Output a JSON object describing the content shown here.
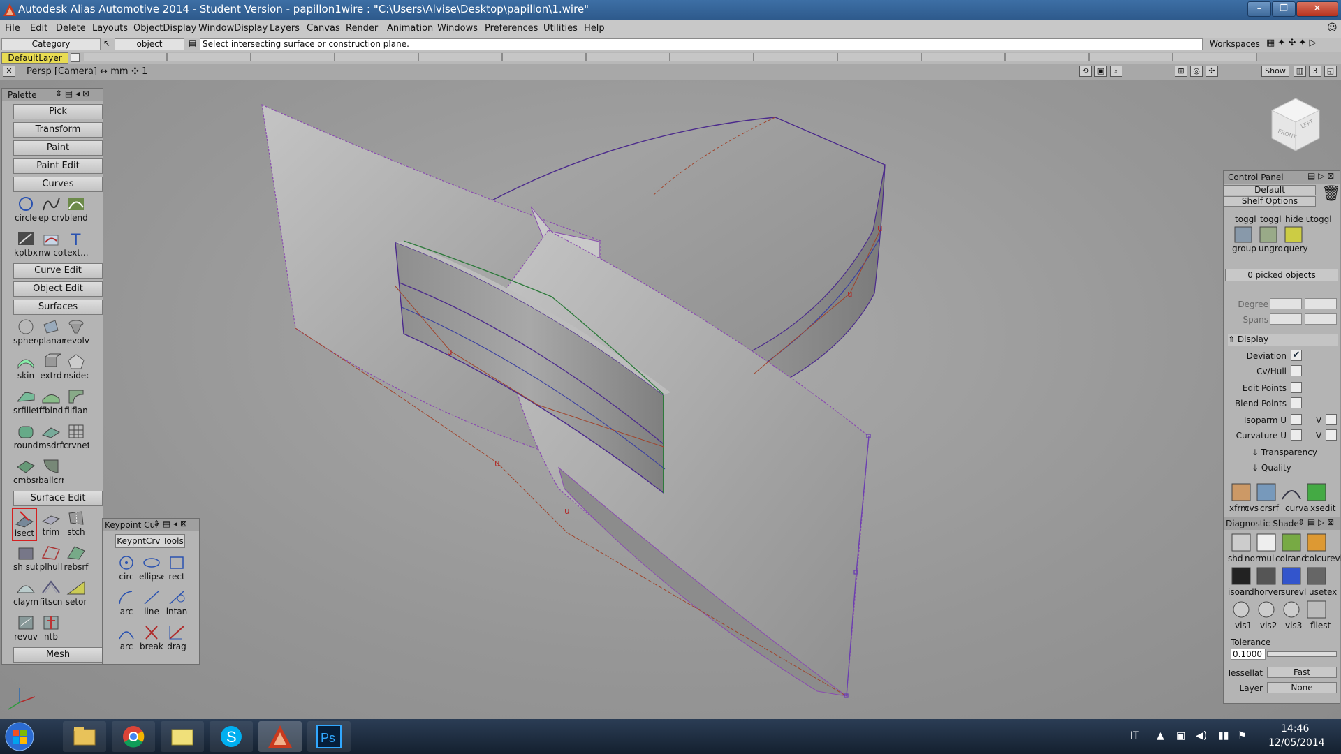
{
  "window": {
    "title": "Autodesk Alias Automotive 2014   - Student Version   - papillon1wire : \"C:\\Users\\Alvise\\Desktop\\papillon\\1.wire\"",
    "minimize": "–",
    "maximize": "❐",
    "close": "✕"
  },
  "menu": [
    "File",
    "Edit",
    "Delete",
    "Layouts",
    "ObjectDisplay",
    "WindowDisplay",
    "Layers",
    "Canvas",
    "Render",
    "Animation",
    "Windows",
    "Preferences",
    "Utilities",
    "Help"
  ],
  "toolbar": {
    "category_label": "Category",
    "object_label": "object",
    "prompt": "Select intersecting surface or construction plane.",
    "workspaces_label": "Workspaces"
  },
  "layer_bar": {
    "default_layer": "DefaultLayer"
  },
  "view_bar": {
    "camera": "Persp [Camera] ↔ mm",
    "count": "✣ 1",
    "show_label": "Show",
    "view_number": "3"
  },
  "palette": {
    "title": "Palette",
    "top_buttons": [
      "Pick",
      "Transform",
      "Paint",
      "Paint Edit"
    ],
    "curves_header": "Curves",
    "curves_tools": [
      "circle",
      "ep crv",
      "blend",
      "kptbx",
      "nw cos",
      "text..."
    ],
    "curve_edit": "Curve Edit",
    "object_edit": "Object Edit",
    "surfaces_header": "Surfaces",
    "surfaces_tools": [
      "sphere",
      "planar",
      "revolv",
      "skin",
      "extrd",
      "nsided",
      "srfillet",
      "ffblnd",
      "filflan",
      "round",
      "msdrft",
      "crvnet",
      "cmbsrf",
      "ballcrn"
    ],
    "surface_edit_header": "Surface Edit",
    "surface_edit_tools": [
      "isect",
      "trim",
      "stch",
      "sh sub",
      "plhull",
      "rebsrf",
      "claymt",
      "fitscn",
      "setor",
      "revuv",
      "ntb"
    ],
    "mesh_header": "Mesh"
  },
  "keypoint": {
    "title": "Keypoint Cur",
    "tab": "KeypntCrv Tools",
    "tools": [
      "circ",
      "ellipse",
      "rect",
      "arc",
      "line",
      "lntan",
      "arc",
      "break",
      "drag"
    ]
  },
  "control_panel": {
    "title": "Control Panel",
    "preset": "Default",
    "shelf_options": "Shelf Options",
    "shelf_row1": [
      "toggl",
      "toggl",
      "hide u",
      "toggl"
    ],
    "shelf_row2": [
      "group",
      "ungro",
      "query"
    ],
    "picked": "0 picked objects",
    "degree_label": "Degree",
    "spans_label": "Spans",
    "display_header": "Display",
    "display_rows": [
      {
        "label": "Deviation",
        "checked": "✔"
      },
      {
        "label": "Cv/Hull",
        "checked": ""
      },
      {
        "label": "Edit Points",
        "checked": ""
      },
      {
        "label": "Blend Points",
        "checked": ""
      },
      {
        "label": "Isoparm U",
        "checked": "",
        "v": "V"
      },
      {
        "label": "Curvature U",
        "checked": "",
        "v": "V"
      }
    ],
    "transparency": "Transparency",
    "quality": "Quality",
    "tool_row": [
      "xfrm",
      "cvs",
      "crsrf",
      "curva",
      "xsedit"
    ],
    "diag_title": "Diagnostic Shade",
    "diag_row1": [
      "shd",
      "normul",
      "colrand",
      "colcurevl"
    ],
    "diag_row2": [
      "isoan",
      "dhorver",
      "surevl",
      "usetex"
    ],
    "diag_row3": [
      "vis1",
      "vis2",
      "vis3",
      "fllest"
    ],
    "tolerance_label": "Tolerance",
    "tolerance_value": "0.1000",
    "tessellate_label": "Tessellat",
    "tessellate_value": "Fast",
    "layer_label": "Layer",
    "layer_value": "None"
  },
  "taskbar": {
    "lang": "IT",
    "time": "14:46",
    "date": "12/05/2014",
    "apps": [
      "explorer",
      "chrome",
      "folder",
      "skype",
      "alias",
      "photoshop"
    ],
    "ps_label": "Ps",
    "skype_label": "S"
  },
  "colors": {
    "title_bar": "#2e5a8c",
    "surface": "#b4b4b4",
    "curve_purple": "#4b2a8c",
    "hull_red": "#a0442c",
    "edge_green": "#2e7a3c"
  }
}
